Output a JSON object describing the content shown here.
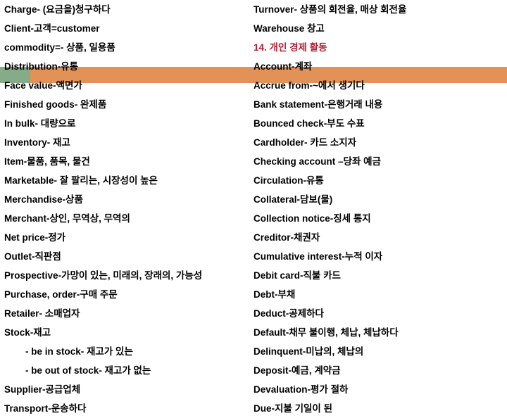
{
  "slide": {
    "background_color": "#ffffff",
    "text_color": "#000000",
    "highlight_orange": "#e29257",
    "highlight_green": "#85ab89",
    "heading_red": "#b01c2e"
  },
  "left_column": {
    "lines": [
      {
        "text": "Charge- (요금을)청구하다",
        "indent": false,
        "style": "normal"
      },
      {
        "text": "Client-고객=customer",
        "indent": false,
        "style": "normal"
      },
      {
        "text": "commodity=- 상품, 일용품",
        "indent": false,
        "style": "normal"
      },
      {
        "text": "Distribution-유통",
        "indent": false,
        "style": "normal"
      },
      {
        "text": "Face value-액면가",
        "indent": false,
        "style": "highlighted"
      },
      {
        "text": "Finished goods- 완제품",
        "indent": false,
        "style": "normal"
      },
      {
        "text": "In bulk- 대량으로",
        "indent": false,
        "style": "normal"
      },
      {
        "text": "Inventory- 재고",
        "indent": false,
        "style": "normal"
      },
      {
        "text": "Item-물품, 품목, 물건",
        "indent": false,
        "style": "normal"
      },
      {
        "text": "Marketable- 잘 팔리는, 시장성이  높은",
        "indent": false,
        "style": "normal"
      },
      {
        "text": "Merchandise-상품",
        "indent": false,
        "style": "normal"
      },
      {
        "text": "Merchant-상인, 무역상, 무역의",
        "indent": false,
        "style": "normal"
      },
      {
        "text": "Net price-정가",
        "indent": false,
        "style": "normal"
      },
      {
        "text": "Outlet-직판점",
        "indent": false,
        "style": "normal"
      },
      {
        "text": "Prospective-가망이 있는, 미래의, 장래의, 가능성",
        "indent": false,
        "style": "normal"
      },
      {
        "text": "Purchase, order-구매 주문",
        "indent": false,
        "style": "normal"
      },
      {
        "text": "Retailer- 소매업자",
        "indent": false,
        "style": "normal"
      },
      {
        "text": "Stock-재고",
        "indent": false,
        "style": "normal"
      },
      {
        "text": "- be in stock- 재고가 있는",
        "indent": true,
        "style": "normal"
      },
      {
        "text": "- be out of stock- 재고가 없는",
        "indent": true,
        "style": "normal"
      },
      {
        "text": "Supplier-공급업체",
        "indent": false,
        "style": "normal"
      },
      {
        "text": "Transport-운송하다",
        "indent": false,
        "style": "normal"
      }
    ]
  },
  "right_column": {
    "lines": [
      {
        "text": "Turnover- 상품의 회전율, 매상 회전율",
        "indent": false,
        "style": "normal"
      },
      {
        "text": "Warehouse 창고",
        "indent": false,
        "style": "normal"
      },
      {
        "text": "14. 개인 경제 활동",
        "indent": false,
        "style": "red-heading"
      },
      {
        "text": "Account-계좌",
        "indent": false,
        "style": "normal"
      },
      {
        "text": "Accrue from-~에서 생기다",
        "indent": false,
        "style": "highlighted"
      },
      {
        "text": "Bank statement-은행거래 내용",
        "indent": false,
        "style": "normal"
      },
      {
        "text": "Bounced check-부도 수표",
        "indent": false,
        "style": "normal"
      },
      {
        "text": "Cardholder- 카드 소지자",
        "indent": false,
        "style": "normal"
      },
      {
        "text": "Checking account –당좌 예금",
        "indent": false,
        "style": "normal"
      },
      {
        "text": "Circulation-유통",
        "indent": false,
        "style": "normal"
      },
      {
        "text": "Collateral-담보(물)",
        "indent": false,
        "style": "normal"
      },
      {
        "text": "Collection notice-징세 통지",
        "indent": false,
        "style": "normal"
      },
      {
        "text": "Creditor-채권자",
        "indent": false,
        "style": "normal"
      },
      {
        "text": "Cumulative interest-누적 이자",
        "indent": false,
        "style": "normal"
      },
      {
        "text": "Debit card-직불 카드",
        "indent": false,
        "style": "normal"
      },
      {
        "text": "Debt-부채",
        "indent": false,
        "style": "normal"
      },
      {
        "text": "Deduct-공제하다",
        "indent": false,
        "style": "normal"
      },
      {
        "text": "Default-채무 불이행, 체납, 체납하다",
        "indent": false,
        "style": "normal"
      },
      {
        "text": "Delinquent-미납의, 체납의",
        "indent": false,
        "style": "normal"
      },
      {
        "text": "Deposit-예금, 계약금",
        "indent": false,
        "style": "normal"
      },
      {
        "text": "Devaluation-평가 절하",
        "indent": false,
        "style": "normal"
      },
      {
        "text": "Due-지불 기일이 된",
        "indent": false,
        "style": "normal"
      }
    ]
  }
}
